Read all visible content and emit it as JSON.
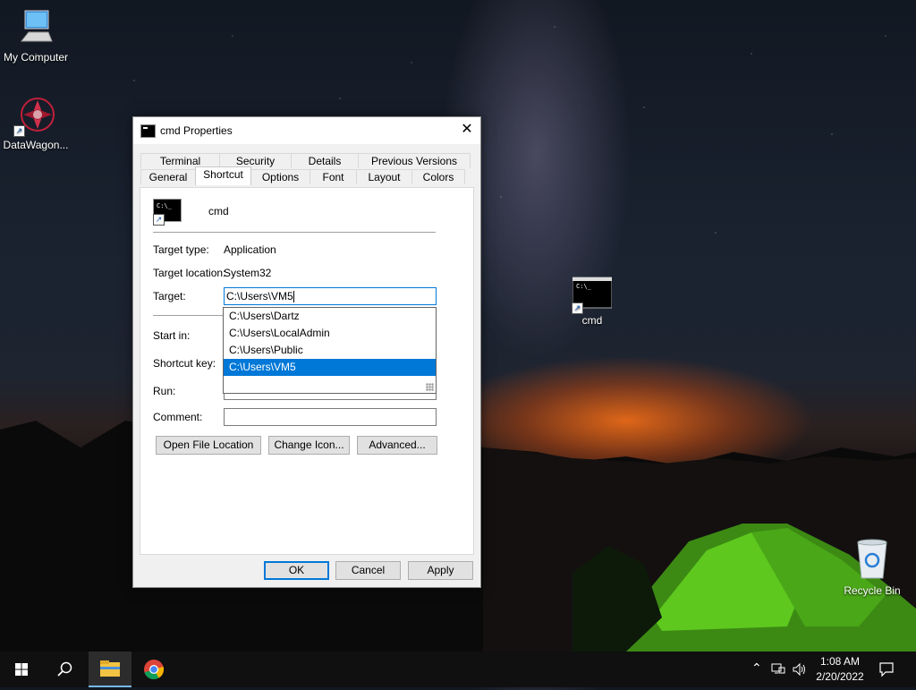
{
  "desktop": {
    "icons": [
      {
        "label": "My Computer",
        "icon": "computer-icon"
      },
      {
        "label": "DataWagon...",
        "icon": "datawagon-icon"
      },
      {
        "label": "cmd",
        "icon": "cmd-icon"
      },
      {
        "label": "Recycle Bin",
        "icon": "recycle-bin-icon"
      }
    ]
  },
  "dialog": {
    "title": "cmd Properties",
    "close_icon": "close-icon",
    "tabs_back": [
      "Terminal",
      "Security",
      "Details",
      "Previous Versions"
    ],
    "tabs_front": [
      "General",
      "Shortcut",
      "Options",
      "Font",
      "Layout",
      "Colors"
    ],
    "active_tab": "Shortcut",
    "shortcut_name": "cmd",
    "target_type_label": "Target type:",
    "target_type_value": "Application",
    "target_location_label": "Target location:",
    "target_location_value": "System32",
    "target_label": "Target:",
    "target_value": "C:\\Users\\VM5",
    "autocomplete_items": [
      "C:\\Users\\Dartz",
      "C:\\Users\\LocalAdmin",
      "C:\\Users\\Public",
      "C:\\Users\\VM5"
    ],
    "autocomplete_selected_index": 3,
    "start_in_label": "Start in:",
    "shortcut_key_label": "Shortcut key:",
    "run_label": "Run:",
    "comment_label": "Comment:",
    "comment_value": "",
    "buttons": {
      "open_file_location": "Open File Location",
      "change_icon": "Change Icon...",
      "advanced": "Advanced...",
      "ok": "OK",
      "cancel": "Cancel",
      "apply": "Apply"
    }
  },
  "taskbar": {
    "start_icon": "windows-start-icon",
    "search_icon": "search-icon",
    "pinned": [
      "file-explorer-icon",
      "chrome-icon"
    ],
    "tray_icons": [
      "chevron-up-icon",
      "network-icon",
      "volume-icon"
    ],
    "time": "1:08 AM",
    "date": "2/20/2022",
    "notification_icon": "notification-icon"
  }
}
